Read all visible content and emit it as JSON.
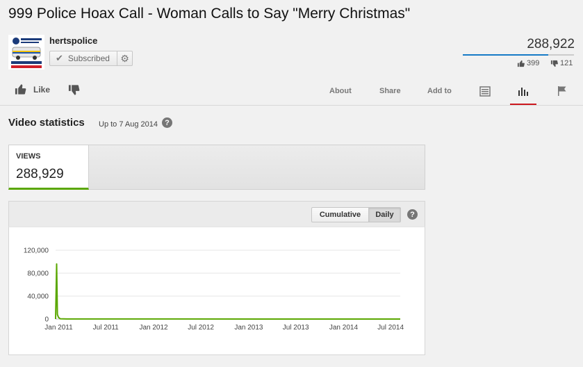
{
  "video": {
    "title": "999 Police Hoax Call - Woman Calls to Say \"Merry Christmas\"",
    "view_count": "288,922",
    "likes": "399",
    "dislikes": "121",
    "like_ratio": 0.767
  },
  "channel": {
    "name": "hertspolice",
    "subscribe_label": "Subscribed",
    "logo_icon": "herts-police-logo-icon"
  },
  "actions": {
    "like_label": "Like",
    "tabs": [
      "About",
      "Share",
      "Add to"
    ],
    "active_tab_color": "#cc181e"
  },
  "stats": {
    "heading": "Video statistics",
    "date_label": "Up to 7 Aug 2014",
    "help": "?",
    "metric_label": "VIEWS",
    "metric_value": "288,929",
    "metric_accent": "#5aa700",
    "toggle": {
      "cumulative": "Cumulative",
      "daily": "Daily",
      "selected": "Daily"
    }
  },
  "chart_data": {
    "type": "line",
    "x_ticks": [
      "Jan 2011",
      "Jul 2011",
      "Jan 2012",
      "Jul 2012",
      "Jan 2013",
      "Jul 2013",
      "Jan 2014",
      "Jul 2014"
    ],
    "y_ticks": [
      "0",
      "40,000",
      "80,000",
      "120,000"
    ],
    "ylim": [
      0,
      120000
    ],
    "x_range": [
      "2010-12-20",
      "2014-08-07"
    ],
    "series": [
      {
        "color": "#5aa700",
        "points": [
          [
            "2010-12-20",
            0
          ],
          [
            "2010-12-24",
            96000
          ],
          [
            "2010-12-27",
            8000
          ],
          [
            "2010-12-31",
            3000
          ],
          [
            "2011-01-07",
            500
          ],
          [
            "2011-02-01",
            100
          ],
          [
            "2014-08-07",
            50
          ]
        ]
      }
    ],
    "grid": true
  }
}
